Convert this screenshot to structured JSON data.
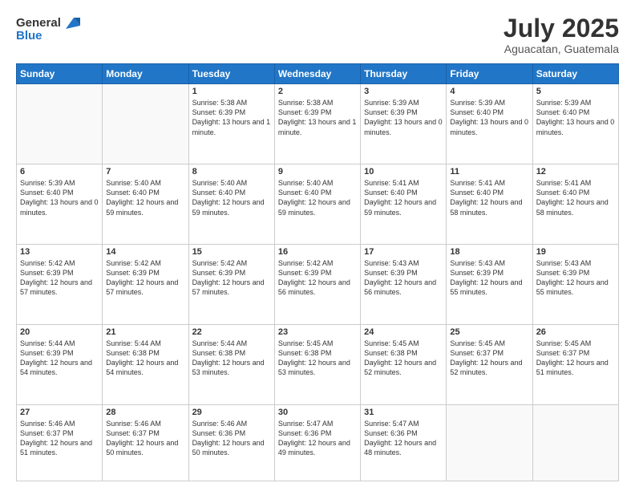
{
  "header": {
    "logo_general": "General",
    "logo_blue": "Blue",
    "title": "July 2025",
    "subtitle": "Aguacatan, Guatemala"
  },
  "days_of_week": [
    "Sunday",
    "Monday",
    "Tuesday",
    "Wednesday",
    "Thursday",
    "Friday",
    "Saturday"
  ],
  "weeks": [
    [
      {
        "day": "",
        "info": ""
      },
      {
        "day": "",
        "info": ""
      },
      {
        "day": "1",
        "info": "Sunrise: 5:38 AM\nSunset: 6:39 PM\nDaylight: 13 hours and 1 minute."
      },
      {
        "day": "2",
        "info": "Sunrise: 5:38 AM\nSunset: 6:39 PM\nDaylight: 13 hours and 1 minute."
      },
      {
        "day": "3",
        "info": "Sunrise: 5:39 AM\nSunset: 6:39 PM\nDaylight: 13 hours and 0 minutes."
      },
      {
        "day": "4",
        "info": "Sunrise: 5:39 AM\nSunset: 6:40 PM\nDaylight: 13 hours and 0 minutes."
      },
      {
        "day": "5",
        "info": "Sunrise: 5:39 AM\nSunset: 6:40 PM\nDaylight: 13 hours and 0 minutes."
      }
    ],
    [
      {
        "day": "6",
        "info": "Sunrise: 5:39 AM\nSunset: 6:40 PM\nDaylight: 13 hours and 0 minutes."
      },
      {
        "day": "7",
        "info": "Sunrise: 5:40 AM\nSunset: 6:40 PM\nDaylight: 12 hours and 59 minutes."
      },
      {
        "day": "8",
        "info": "Sunrise: 5:40 AM\nSunset: 6:40 PM\nDaylight: 12 hours and 59 minutes."
      },
      {
        "day": "9",
        "info": "Sunrise: 5:40 AM\nSunset: 6:40 PM\nDaylight: 12 hours and 59 minutes."
      },
      {
        "day": "10",
        "info": "Sunrise: 5:41 AM\nSunset: 6:40 PM\nDaylight: 12 hours and 59 minutes."
      },
      {
        "day": "11",
        "info": "Sunrise: 5:41 AM\nSunset: 6:40 PM\nDaylight: 12 hours and 58 minutes."
      },
      {
        "day": "12",
        "info": "Sunrise: 5:41 AM\nSunset: 6:40 PM\nDaylight: 12 hours and 58 minutes."
      }
    ],
    [
      {
        "day": "13",
        "info": "Sunrise: 5:42 AM\nSunset: 6:39 PM\nDaylight: 12 hours and 57 minutes."
      },
      {
        "day": "14",
        "info": "Sunrise: 5:42 AM\nSunset: 6:39 PM\nDaylight: 12 hours and 57 minutes."
      },
      {
        "day": "15",
        "info": "Sunrise: 5:42 AM\nSunset: 6:39 PM\nDaylight: 12 hours and 57 minutes."
      },
      {
        "day": "16",
        "info": "Sunrise: 5:42 AM\nSunset: 6:39 PM\nDaylight: 12 hours and 56 minutes."
      },
      {
        "day": "17",
        "info": "Sunrise: 5:43 AM\nSunset: 6:39 PM\nDaylight: 12 hours and 56 minutes."
      },
      {
        "day": "18",
        "info": "Sunrise: 5:43 AM\nSunset: 6:39 PM\nDaylight: 12 hours and 55 minutes."
      },
      {
        "day": "19",
        "info": "Sunrise: 5:43 AM\nSunset: 6:39 PM\nDaylight: 12 hours and 55 minutes."
      }
    ],
    [
      {
        "day": "20",
        "info": "Sunrise: 5:44 AM\nSunset: 6:39 PM\nDaylight: 12 hours and 54 minutes."
      },
      {
        "day": "21",
        "info": "Sunrise: 5:44 AM\nSunset: 6:38 PM\nDaylight: 12 hours and 54 minutes."
      },
      {
        "day": "22",
        "info": "Sunrise: 5:44 AM\nSunset: 6:38 PM\nDaylight: 12 hours and 53 minutes."
      },
      {
        "day": "23",
        "info": "Sunrise: 5:45 AM\nSunset: 6:38 PM\nDaylight: 12 hours and 53 minutes."
      },
      {
        "day": "24",
        "info": "Sunrise: 5:45 AM\nSunset: 6:38 PM\nDaylight: 12 hours and 52 minutes."
      },
      {
        "day": "25",
        "info": "Sunrise: 5:45 AM\nSunset: 6:37 PM\nDaylight: 12 hours and 52 minutes."
      },
      {
        "day": "26",
        "info": "Sunrise: 5:45 AM\nSunset: 6:37 PM\nDaylight: 12 hours and 51 minutes."
      }
    ],
    [
      {
        "day": "27",
        "info": "Sunrise: 5:46 AM\nSunset: 6:37 PM\nDaylight: 12 hours and 51 minutes."
      },
      {
        "day": "28",
        "info": "Sunrise: 5:46 AM\nSunset: 6:37 PM\nDaylight: 12 hours and 50 minutes."
      },
      {
        "day": "29",
        "info": "Sunrise: 5:46 AM\nSunset: 6:36 PM\nDaylight: 12 hours and 50 minutes."
      },
      {
        "day": "30",
        "info": "Sunrise: 5:47 AM\nSunset: 6:36 PM\nDaylight: 12 hours and 49 minutes."
      },
      {
        "day": "31",
        "info": "Sunrise: 5:47 AM\nSunset: 6:36 PM\nDaylight: 12 hours and 48 minutes."
      },
      {
        "day": "",
        "info": ""
      },
      {
        "day": "",
        "info": ""
      }
    ]
  ]
}
